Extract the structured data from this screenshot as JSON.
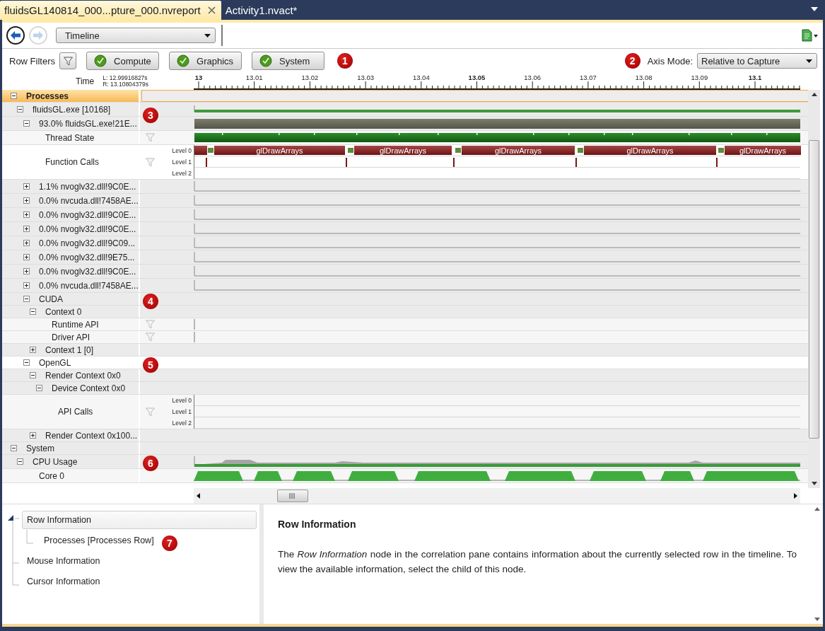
{
  "tabs": [
    {
      "label": "fluidsGL140814_000...pture_000.nvreport",
      "selected": true
    },
    {
      "label": "Activity1.nvact*",
      "selected": false
    }
  ],
  "toolbar": {
    "view": "Timeline"
  },
  "filters": {
    "label": "Row Filters",
    "callout": "1",
    "buttons": [
      {
        "label": "Compute",
        "checked": true
      },
      {
        "label": "Graphics",
        "checked": true
      },
      {
        "label": "System",
        "checked": true
      }
    ]
  },
  "axis_mode": {
    "callout": "2",
    "label": "Axis Mode:",
    "value": "Relative to Capture"
  },
  "time": {
    "label": "Time",
    "left": "L: 12.99916827s",
    "right": "R: 13.10804379s",
    "ticks": [
      {
        "label": "13",
        "bold": true
      },
      {
        "label": "13.01",
        "bold": false
      },
      {
        "label": "13.02",
        "bold": false
      },
      {
        "label": "13.03",
        "bold": false
      },
      {
        "label": "13.04",
        "bold": false
      },
      {
        "label": "13.05",
        "bold": true
      },
      {
        "label": "13.06",
        "bold": false
      },
      {
        "label": "13.07",
        "bold": false
      },
      {
        "label": "13.08",
        "bold": false
      },
      {
        "label": "13.09",
        "bold": false
      },
      {
        "label": "13.1",
        "bold": true
      }
    ]
  },
  "rows": [
    {
      "label": "Processes",
      "expanded": true,
      "kind": "header",
      "children": [
        {
          "label": "fluidsGL.exe [10168]",
          "expanded": true,
          "kind": "line",
          "callout": "3",
          "children": [
            {
              "label": "93.0% fluidsGL.exe!21E...",
              "expanded": true,
              "kind": "usage",
              "children": [
                {
                  "label": "Thread State",
                  "kind": "thread"
                },
                {
                  "label": "Function Calls",
                  "kind": "calls",
                  "levels": [
                    "Level 0",
                    "Level 1",
                    "Level 2"
                  ],
                  "calls": [
                    "glDrawArrays",
                    "glDrawArrays",
                    "glDrawArrays",
                    "glDrawArrays",
                    "glDrawArrays"
                  ]
                }
              ]
            },
            {
              "label": "1.1% nvoglv32.dll!9C0E...",
              "expanded": false,
              "kind": "spark"
            },
            {
              "label": "0.0% nvcuda.dll!7458AE...",
              "expanded": false,
              "kind": "spark"
            },
            {
              "label": "0.0% nvoglv32.dll!9C0E...",
              "expanded": false,
              "kind": "spark"
            },
            {
              "label": "0.0% nvoglv32.dll!9C0E...",
              "expanded": false,
              "kind": "spark"
            },
            {
              "label": "0.0% nvoglv32.dll!9C09...",
              "expanded": false,
              "kind": "spark"
            },
            {
              "label": "0.0% nvoglv32.dll!9E75...",
              "expanded": false,
              "kind": "spark"
            },
            {
              "label": "0.0% nvoglv32.dll!9C0E...",
              "expanded": false,
              "kind": "spark"
            },
            {
              "label": "0.0% nvcuda.dll!7458AE...",
              "expanded": false,
              "kind": "spark"
            },
            {
              "label": "CUDA",
              "expanded": true,
              "callout": "4",
              "children": [
                {
                  "label": "Context 0",
                  "expanded": true,
                  "children": [
                    {
                      "label": "Runtime API",
                      "kind": "axis"
                    },
                    {
                      "label": "Driver API",
                      "kind": "axis"
                    }
                  ]
                },
                {
                  "label": "Context 1 [0]",
                  "expanded": false
                }
              ]
            },
            {
              "label": "OpenGL",
              "expanded": true,
              "callout": "5",
              "children": [
                {
                  "label": "Render Context 0x0",
                  "expanded": true,
                  "children": [
                    {
                      "label": "Device Context 0x0",
                      "expanded": true,
                      "children": [
                        {
                          "label": "API Calls",
                          "kind": "levels",
                          "levels": [
                            "Level 0",
                            "Level 1",
                            "Level 2"
                          ]
                        }
                      ]
                    }
                  ]
                },
                {
                  "label": "Render Context 0x100...",
                  "expanded": false
                }
              ]
            }
          ]
        }
      ]
    },
    {
      "label": "System",
      "expanded": true,
      "children": [
        {
          "label": "CPU Usage",
          "expanded": true,
          "kind": "cpu",
          "callout": "6",
          "children": [
            {
              "label": "Core 0",
              "kind": "core"
            }
          ]
        }
      ]
    }
  ],
  "info": {
    "callout": "7",
    "tree": [
      {
        "label": "Row Information",
        "selected": true,
        "expanded": true,
        "children": [
          {
            "label": "Processes [Processes Row]",
            "selected": false
          }
        ]
      },
      {
        "label": "Mouse Information",
        "selected": false
      },
      {
        "label": "Cursor Information",
        "selected": false
      }
    ],
    "title": "Row Information",
    "text": "The *Row Information* node in the correlation pane contains information about the currently selected row in the timeline. To view the available information, select the child of this node."
  }
}
